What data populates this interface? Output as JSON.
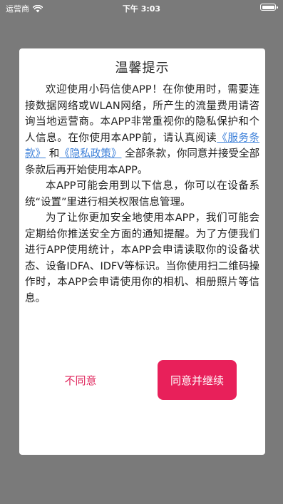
{
  "status_bar": {
    "carrier": "运营商",
    "time": "下午 3:03"
  },
  "dialog": {
    "title": "温馨提示",
    "p1_text1": "欢迎使用小码信使APP！在你使用时，需要连接数据网络或WLAN网络，所产生的流量费用请咨询当地运营商。本APP非常重视你的隐私保护和个人信息。在你使用本APP前，请认真阅读",
    "service_link": "《服务条款》",
    "p1_text2": "和",
    "privacy_link": "《隐私政策》",
    "p1_text3": "全部条款，你同意并接受全部条款后再开始使用本APP。",
    "p2": "本APP可能会用到以下信息，你可以在设备系统“设置”里进行相关权限信息管理。",
    "p3": "为了让你更加安全地使用本APP，我们可能会定期给你推送安全方面的通知提醒。为了方便我们进行APP使用统计，本APP会申请读取你的设备状态、设备IDFA、IDFV等标识。当你使用扫二维码操作时，本APP会申请使用你的相机、相册照片等信息。",
    "decline_label": "不同意",
    "accept_label": "同意并继续"
  },
  "colors": {
    "accent": "#e8205a",
    "link": "#3b7fd9",
    "overlay": "#7a7a7a"
  }
}
